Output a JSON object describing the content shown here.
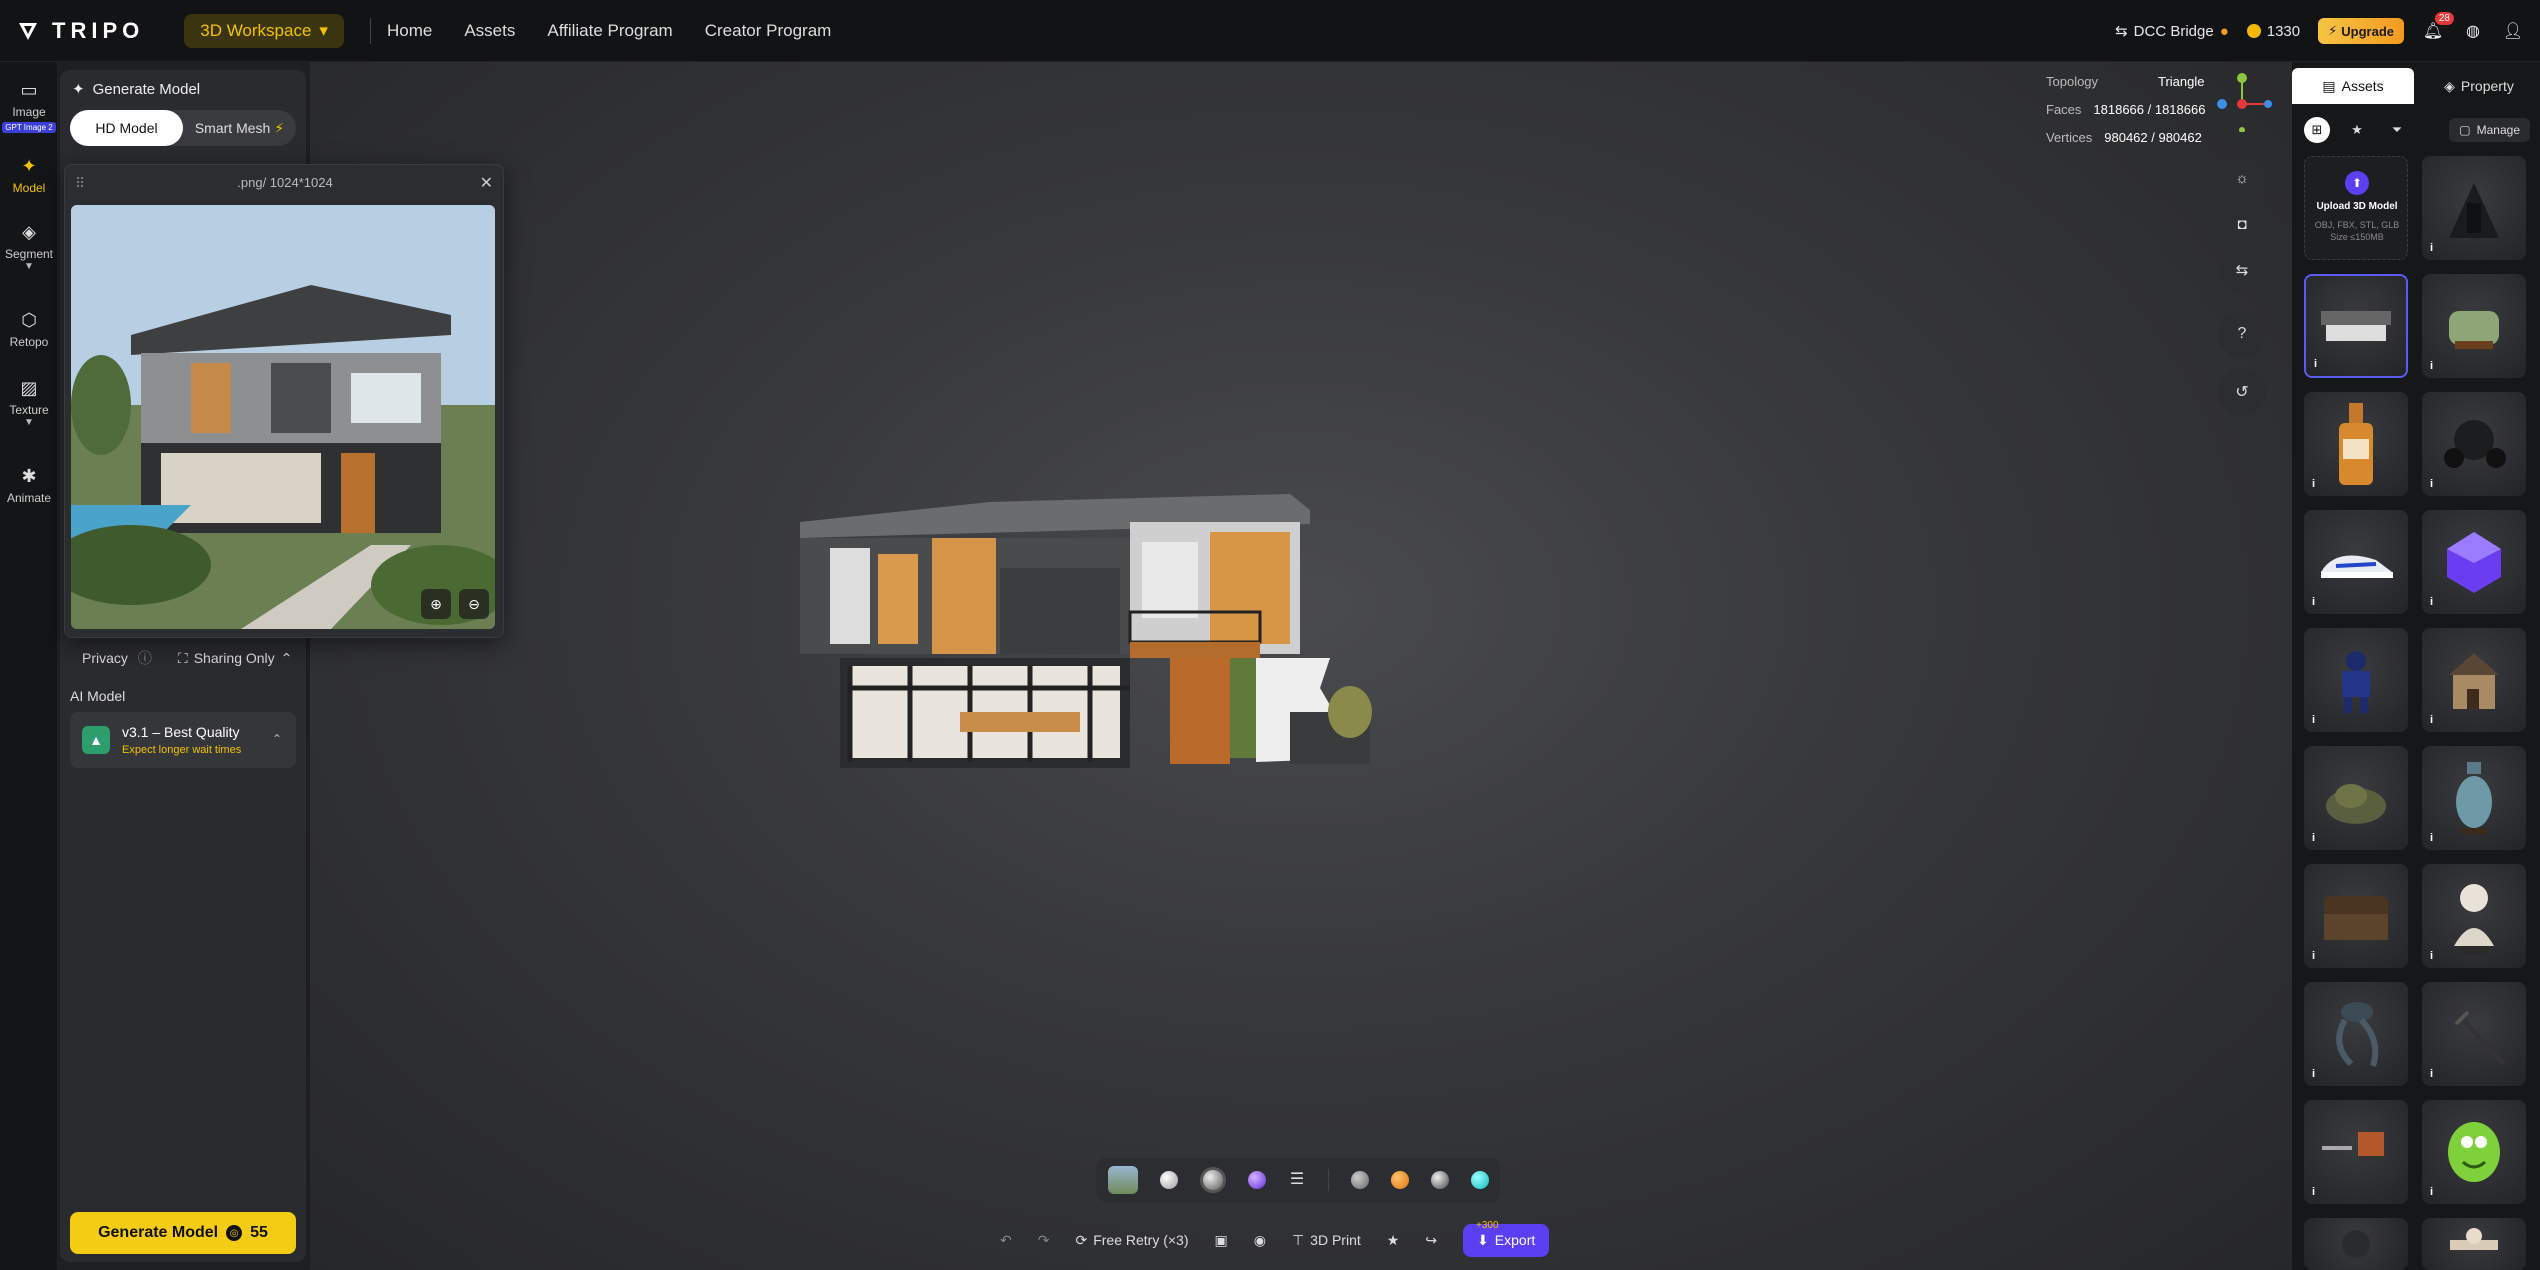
{
  "topbar": {
    "logo": "TRIPO",
    "workspace": "3D Workspace",
    "nav": [
      "Home",
      "Assets",
      "Affiliate Program",
      "Creator Program"
    ],
    "dcc_bridge": "DCC Bridge",
    "credits": "1330",
    "upgrade": "Upgrade",
    "notifications": "28"
  },
  "rail": {
    "image": "Image",
    "image_badge": "GPT Image 2",
    "model": "Model",
    "segment": "Segment",
    "retopo": "Retopo",
    "texture": "Texture",
    "animate": "Animate"
  },
  "panel": {
    "title": "Generate Model",
    "mode_hd": "HD Model",
    "mode_smart": "Smart Mesh",
    "privacy": "Privacy",
    "sharing": "Sharing Only",
    "ai_label": "AI Model",
    "ai_name": "v3.1 – Best Quality",
    "ai_sub": "Expect longer wait times",
    "generate": "Generate Model",
    "generate_cost": "55"
  },
  "popup": {
    "title": ".png/ 1024*1024"
  },
  "stats": {
    "topology_label": "Topology",
    "topology": "Triangle",
    "faces_label": "Faces",
    "faces": "1818666 / 1818666",
    "vertices_label": "Vertices",
    "vertices": "980462 / 980462"
  },
  "actions": {
    "free_retry": "Free Retry (×3)",
    "print": "3D Print",
    "export": "Export",
    "share_bonus": "+300"
  },
  "assets": {
    "tab_assets": "Assets",
    "tab_property": "Property",
    "manage": "Manage",
    "upload_title": "Upload 3D Model",
    "upload_formats": "OBJ, FBX, STL, GLB",
    "upload_size": "Size ≤150MB",
    "info": "i"
  },
  "colors": {
    "accent": "#f5cc14",
    "purple": "#5b3ff2"
  }
}
